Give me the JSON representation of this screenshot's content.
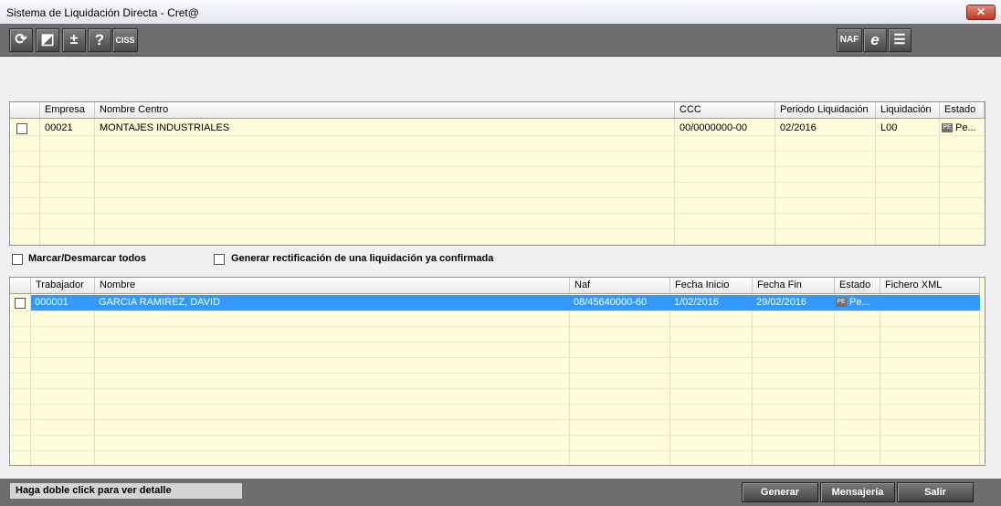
{
  "window": {
    "title": "Sistema de Liquidación Directa - Cret@",
    "close_icon": "✕"
  },
  "toolbar": {
    "left": [
      {
        "name": "refresh-icon",
        "glyph": "⟳"
      },
      {
        "name": "contrast-icon",
        "glyph": "◩"
      },
      {
        "name": "plus-minus-icon",
        "glyph": "±"
      },
      {
        "name": "help-icon",
        "glyph": "?"
      },
      {
        "name": "ciss-button",
        "glyph": "CISS"
      }
    ],
    "right": [
      {
        "name": "naf-button",
        "glyph": "NAF"
      },
      {
        "name": "internet-explorer-icon",
        "glyph": "e"
      },
      {
        "name": "list-icon",
        "glyph": "☰"
      }
    ]
  },
  "grid1": {
    "columns": [
      "",
      "Empresa",
      "Nombre Centro",
      "CCC",
      "Periodo Liquidación",
      "Liquidación",
      "Estado"
    ],
    "rows": [
      {
        "empresa": "00021",
        "nombre": "MONTAJES INDUSTRIALES",
        "ccc": "00/0000000-00",
        "periodo": "02/2016",
        "liquidacion": "L00",
        "estado_badge": "PE",
        "estado": "Pe..."
      }
    ]
  },
  "options": {
    "marcar": "Marcar/Desmarcar todos",
    "generar_rect": "Generar rectificación de una liquidación ya confirmada"
  },
  "grid2": {
    "columns": [
      "",
      "Trabajador",
      "Nombre",
      "Naf",
      "Fecha Inicio",
      "Fecha Fin",
      "Estado",
      "Fichero XML"
    ],
    "rows": [
      {
        "trabajador": "000001",
        "nombre": "GARCIA RAMIREZ, DAVID",
        "naf": "08/45640000-60",
        "inicio": "1/02/2016",
        "fin": "29/02/2016",
        "estado_badge": "PE",
        "estado": "Pe...",
        "fichero": ""
      }
    ]
  },
  "status": "Haga doble click para ver detalle",
  "buttons": {
    "generar": "Generar",
    "mensajeria": "Mensajería",
    "salir": "Salir"
  }
}
